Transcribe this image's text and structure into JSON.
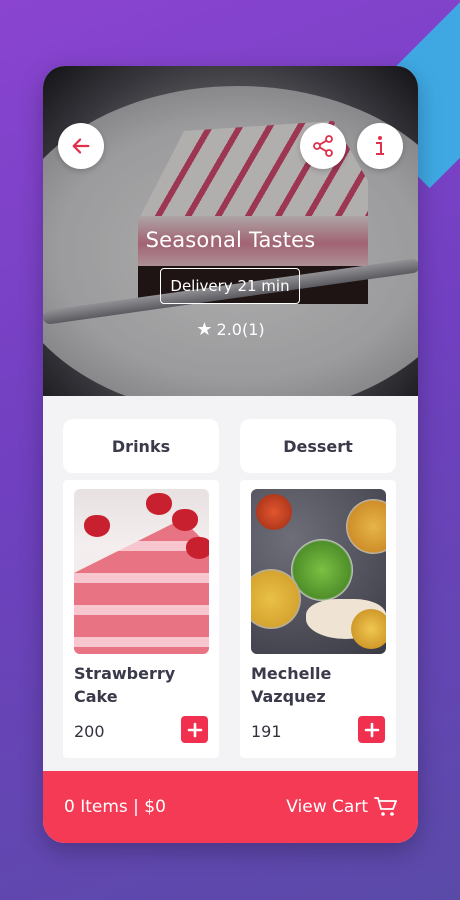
{
  "colors": {
    "accent": "#f53a55",
    "add_button": "#f0304e",
    "background_purple": "#8a44d0",
    "stripe_blue": "#3fa8e3"
  },
  "hero": {
    "title": "Seasonal Tastes",
    "delivery": "Delivery 21 min",
    "rating": "2.0(1)",
    "back_icon": "arrow-left-icon",
    "share_icon": "share-icon",
    "info_icon": "info-icon"
  },
  "categories": [
    {
      "label": "Drinks"
    },
    {
      "label": "Dessert"
    }
  ],
  "products": [
    {
      "name": "Strawberry Cake",
      "price": "200",
      "image": "strawberry-cake-image"
    },
    {
      "name": "Mechelle Vazquez",
      "price": "191",
      "image": "curry-dishes-image"
    }
  ],
  "cart": {
    "summary": "0 Items | $0",
    "view_label": "View Cart",
    "icon": "cart-icon"
  }
}
